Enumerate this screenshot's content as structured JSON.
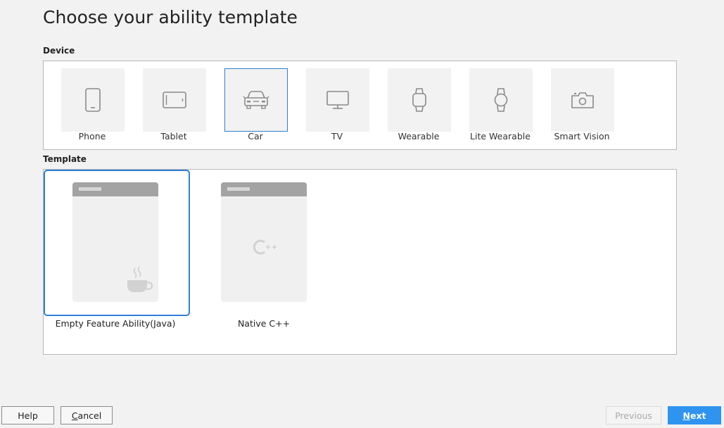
{
  "page_title": "Choose your ability template",
  "device_section": {
    "label": "Device",
    "items": [
      {
        "label": "Phone",
        "icon": "phone-icon",
        "selected": false
      },
      {
        "label": "Tablet",
        "icon": "tablet-icon",
        "selected": false
      },
      {
        "label": "Car",
        "icon": "car-icon",
        "selected": true
      },
      {
        "label": "TV",
        "icon": "tv-icon",
        "selected": false
      },
      {
        "label": "Wearable",
        "icon": "smartwatch-icon",
        "selected": false
      },
      {
        "label": "Lite Wearable",
        "icon": "round-watch-icon",
        "selected": false
      },
      {
        "label": "Smart Vision",
        "icon": "camera-icon",
        "selected": false
      }
    ]
  },
  "template_section": {
    "label": "Template",
    "items": [
      {
        "label": "Empty Feature Ability(Java)",
        "icon": "coffee-cup-icon",
        "selected": true
      },
      {
        "label": "Native C++",
        "icon": "cpp-logo-icon",
        "selected": false
      }
    ]
  },
  "buttons": {
    "help": "Help",
    "cancel_first": "C",
    "cancel_rest": "ancel",
    "previous": "Previous",
    "next_first": "N",
    "next_rest": "ext"
  },
  "colors": {
    "accent": "#2f7fd6",
    "primary_button": "#2f94f0",
    "icon_gray": "#8a8a8a"
  }
}
